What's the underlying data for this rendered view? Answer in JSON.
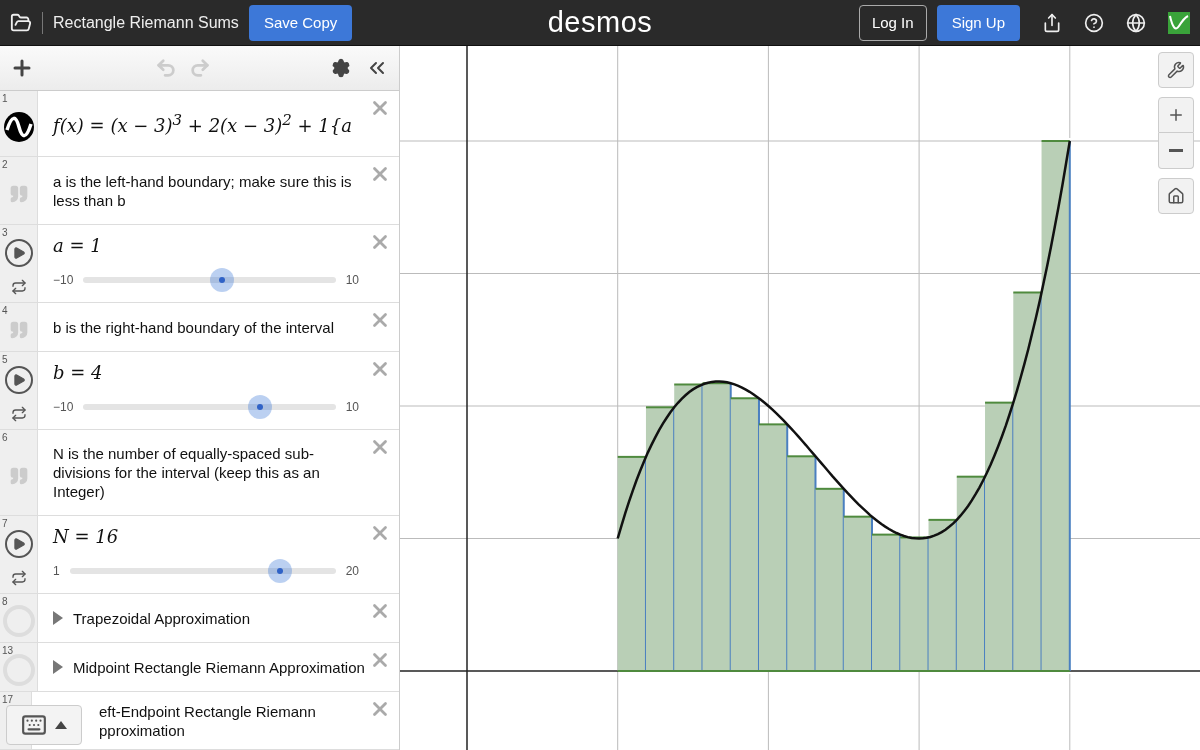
{
  "header": {
    "title": "Rectangle Riemann Sums",
    "save_button": "Save Copy",
    "logo": "desmos",
    "login_button": "Log In",
    "signup_button": "Sign Up"
  },
  "expressions": [
    {
      "kind": "function",
      "number": "1",
      "text": "f(x) = (x − 3)$^{3}$ + 2(x − 3)$^{2}$ + 1{a"
    },
    {
      "kind": "note",
      "number": "2",
      "text": "a is the left-hand boundary; make sure this is less than b"
    },
    {
      "kind": "slider",
      "number": "3",
      "text": "a = 1",
      "min": "−10",
      "max": "10",
      "level": 0.55
    },
    {
      "kind": "note",
      "number": "4",
      "text": "b is the right-hand boundary of the interval"
    },
    {
      "kind": "slider",
      "number": "5",
      "text": "b = 4",
      "min": "−10",
      "max": "10",
      "level": 0.7
    },
    {
      "kind": "note",
      "number": "6",
      "text": "N is the number of equally-spaced sub-divisions for the interval (keep this as an Integer)"
    },
    {
      "kind": "slider",
      "number": "7",
      "text": "N = 16",
      "min": "1",
      "max": "20",
      "level": 0.79
    },
    {
      "kind": "folder",
      "number": "8",
      "text": "Trapezoidal Approximation",
      "expanded": false
    },
    {
      "kind": "folder",
      "number": "13",
      "text": "Midpoint Rectangle Riemann Approximation",
      "expanded": false
    },
    {
      "kind": "covered_folder",
      "number": "17",
      "text": "eft-Endpoint Rectangle Riemann pproximation"
    }
  ]
}
